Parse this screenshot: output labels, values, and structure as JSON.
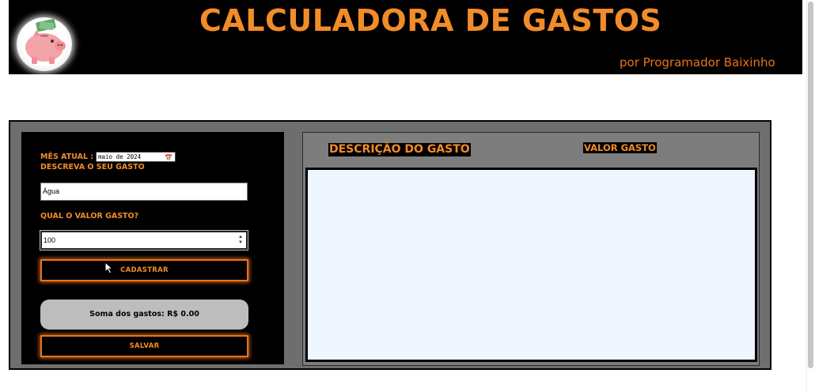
{
  "header": {
    "title": "CALCULADORA DE GASTOS",
    "byline": "por Programador Baixinho",
    "logo_icon": "piggy-bank-icon"
  },
  "form": {
    "month_label": "MÊS ATUAL :",
    "month_value": "maio de 2024",
    "description_label": "DESCREVA O SEU GASTO",
    "description_value": "Água",
    "amount_label": "QUAL O VALOR GASTO?",
    "amount_value": "100",
    "register_button": "CADASTRAR",
    "total_text": "Soma dos gastos: R$ 0.00",
    "save_button": "SALVAR"
  },
  "list": {
    "col_description": "DESCRIÇÃO DO GASTO",
    "col_amount": "VALOR GASTO",
    "items": []
  },
  "colors": {
    "accent": "#f28c28",
    "header_bg": "#000000",
    "panel_bg": "#6e6e6e",
    "list_bg": "#eff6ff"
  }
}
